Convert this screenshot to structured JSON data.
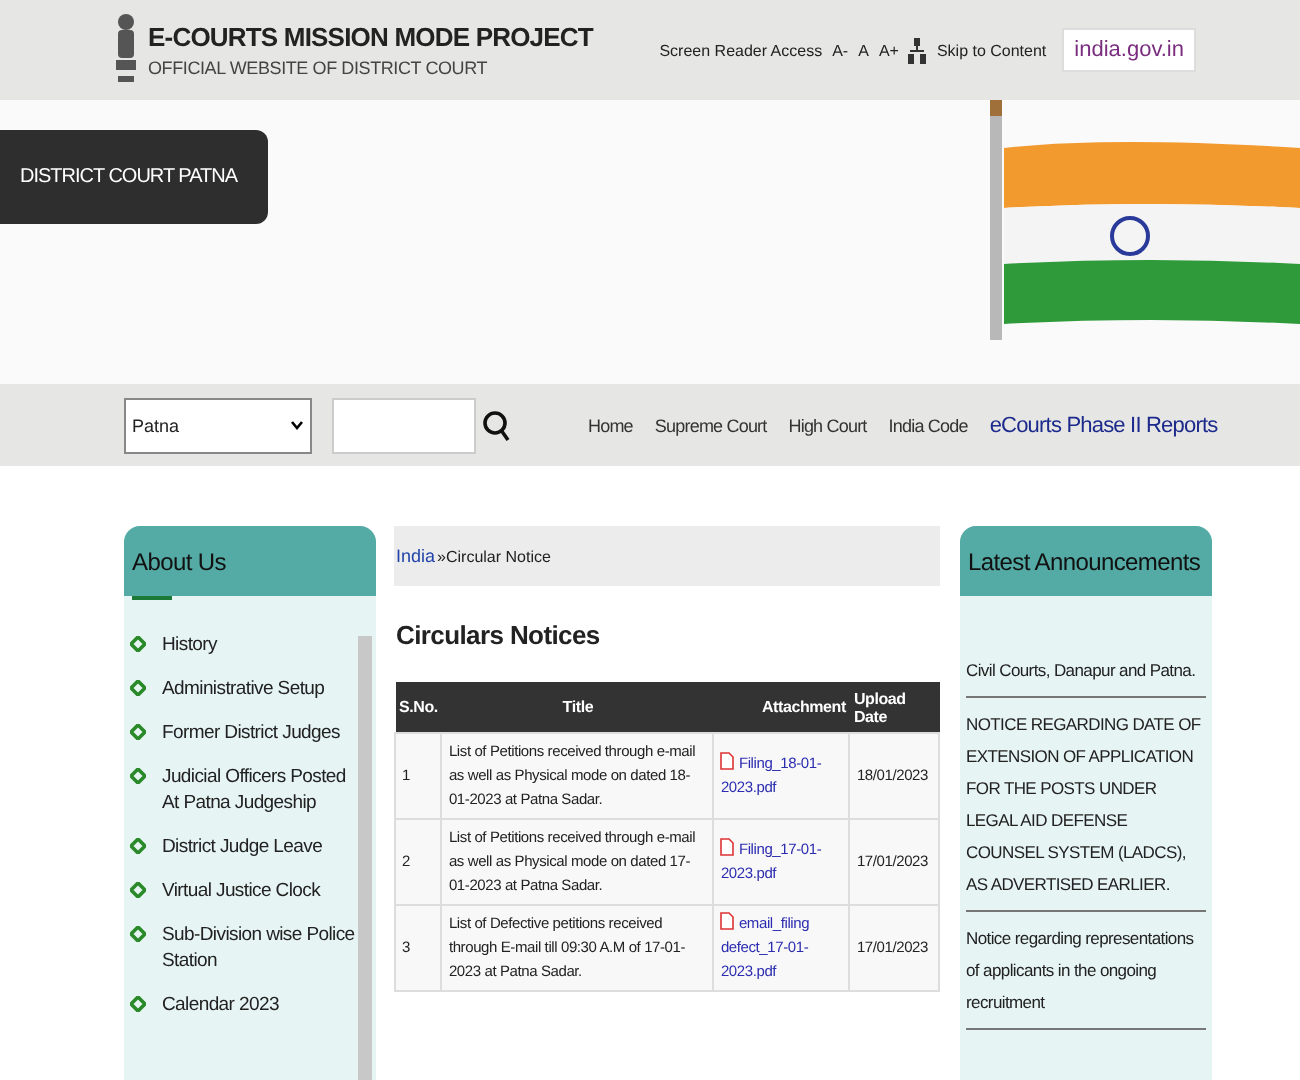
{
  "header": {
    "title": "E-COURTS MISSION MODE PROJECT",
    "subtitle": "OFFICIAL WEBSITE OF DISTRICT COURT",
    "links": [
      "Screen Reader Access",
      "A-",
      "A",
      "A+",
      "Skip to Content"
    ],
    "portal_logo": "india.gov.in"
  },
  "banner": {
    "court_name": "DISTRICT COURT PATNA"
  },
  "nav": {
    "district_select": "Patna",
    "links": [
      {
        "label": "Home",
        "kind": "plain"
      },
      {
        "label": "Supreme Court",
        "kind": "plain"
      },
      {
        "label": "High Court",
        "kind": "plain"
      },
      {
        "label": "India Code",
        "kind": "plain"
      },
      {
        "label": "eCourts Phase II Reports",
        "kind": "featured"
      }
    ]
  },
  "sidebar": {
    "title": "About Us",
    "items": [
      "History",
      "Administrative Setup",
      "Former District Judges",
      "Judicial Officers Posted At Patna Judgeship",
      "District Judge Leave",
      "Virtual Justice Clock",
      "Sub-Division wise Police Station",
      "Calendar 2023"
    ]
  },
  "breadcrumb": {
    "link": "India",
    "current": "»Circular Notice"
  },
  "main": {
    "title": "Circulars Notices",
    "table": {
      "columns": [
        "S.No.",
        "Title",
        "Attachment",
        "Upload Date"
      ],
      "rows": [
        {
          "sno": "1",
          "title": "List of Petitions received through e-mail as well as Physical mode on dated 18-01-2023 at Patna Sadar.",
          "attachment": "Filing_18-01-2023.pdf",
          "date": "18/01/2023"
        },
        {
          "sno": "2",
          "title": "List of Petitions received through e-mail as well as Physical mode on dated 17-01-2023 at Patna Sadar.",
          "attachment": "Filing_17-01-2023.pdf",
          "date": "17/01/2023"
        },
        {
          "sno": "3",
          "title": "List of Defective petitions received through E-mail till 09:30 A.M of 17-01-2023 at Patna Sadar.",
          "attachment": "email_filing defect_17-01-2023.pdf",
          "date": "17/01/2023"
        }
      ]
    }
  },
  "announcements": {
    "title": "Latest Announcements",
    "items": [
      "Civil Courts, Danapur and Patna.",
      "NOTICE REGARDING DATE OF EXTENSION OF APPLICATION FOR THE POSTS UNDER LEGAL AID DEFENSE COUNSEL SYSTEM (LADCS), AS ADVERTISED EARLIER.",
      "Notice regarding representations of applicants in the ongoing recruitment"
    ]
  }
}
